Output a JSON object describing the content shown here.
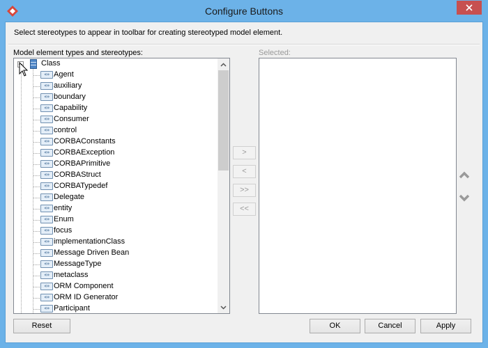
{
  "window": {
    "title": "Configure Buttons"
  },
  "instruction": "Select stereotypes to appear in toolbar for creating stereotyped model element.",
  "left_panel": {
    "label": "Model element types and stereotypes:",
    "root": {
      "label": "Class",
      "icon": "class-icon"
    },
    "items": [
      "Agent",
      "auxiliary",
      "boundary",
      "Capability",
      "Consumer",
      "control",
      "CORBAConstants",
      "CORBAException",
      "CORBAPrimitive",
      "CORBAStruct",
      "CORBATypedef",
      "Delegate",
      "entity",
      "Enum",
      "focus",
      "implementationClass",
      "Message Driven Bean",
      "MessageType",
      "metaclass",
      "ORM Component",
      "ORM ID Generator",
      "Participant"
    ],
    "stereotype_icon_text": "«»"
  },
  "right_panel": {
    "label": "Selected:"
  },
  "transfer_buttons": {
    "add": ">",
    "remove": "<",
    "add_all": ">>",
    "remove_all": "<<"
  },
  "footer": {
    "reset": "Reset",
    "ok": "OK",
    "cancel": "Cancel",
    "apply": "Apply"
  },
  "colors": {
    "title_bar": "#6cb2e8",
    "close_button": "#c75050",
    "dialog_bg": "#f0f0f0"
  }
}
